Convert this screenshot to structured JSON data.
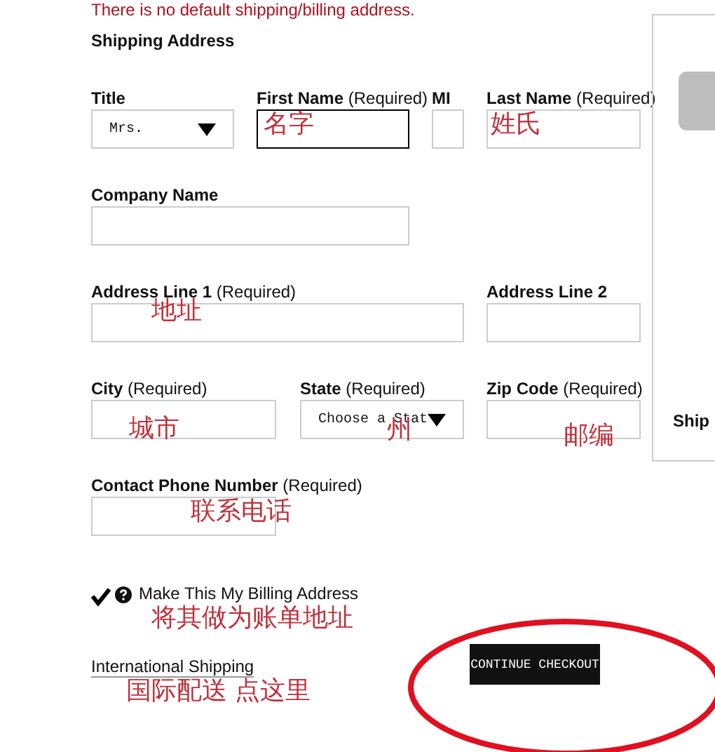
{
  "notice": "There is no default shipping/billing address.",
  "section_title": "Shipping Address",
  "rows": [
    {
      "fields": [
        {
          "kind": "select",
          "label": "Title",
          "value": "Mrs."
        },
        {
          "kind": "text",
          "label": "First Name",
          "qualifier": "(Required)",
          "focused": true,
          "annotation": "名字"
        },
        {
          "kind": "text",
          "label": "MI"
        },
        {
          "kind": "text",
          "label": "Last Name",
          "qualifier": "(Required)",
          "annotation": "姓氏"
        }
      ]
    },
    {
      "fields": [
        {
          "kind": "text",
          "label": "Company Name"
        }
      ]
    },
    {
      "fields": [
        {
          "kind": "text",
          "label": "Address Line 1",
          "qualifier": "(Required)",
          "annotation": "地址"
        },
        {
          "kind": "text",
          "label": "Address Line 2"
        }
      ]
    },
    {
      "fields": [
        {
          "kind": "text",
          "label": "City",
          "qualifier": "(Required)",
          "annotation": "城市"
        },
        {
          "kind": "select",
          "label": "State",
          "qualifier": "(Required)",
          "value": "Choose a Stat",
          "annotation": "州"
        },
        {
          "kind": "text",
          "label": "Zip Code",
          "qualifier": "(Required)",
          "annotation": "邮编"
        }
      ]
    },
    {
      "fields": [
        {
          "kind": "text",
          "label": "Contact Phone Number",
          "qualifier": "(Required)",
          "annotation": "联系电话"
        }
      ]
    }
  ],
  "billing_checkbox": {
    "label": "Make This My Billing Address",
    "checked": true,
    "annotation": "将其做为账单地址"
  },
  "international_shipping": {
    "label": "International Shipping",
    "annotation": "国际配送 点这里"
  },
  "continue_button": "CONTINUE CHECKOUT",
  "side_panel": {
    "label": "Ship"
  }
}
